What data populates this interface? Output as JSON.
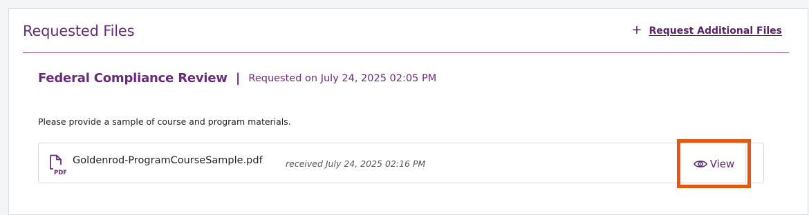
{
  "section": {
    "title": "Requested Files",
    "request_more_label": "Request Additional Files",
    "plus_symbol": "+"
  },
  "request": {
    "title": "Federal Compliance Review",
    "separator": "|",
    "requested_on": "Requested on July 24, 2025 02:05 PM",
    "description": "Please provide a sample of course and program materials."
  },
  "file": {
    "name": "Goldenrod-ProgramCourseSample.pdf",
    "received": "received July 24, 2025 02:16 PM",
    "icon_label": "PDF",
    "view_label": "View"
  },
  "colors": {
    "brand_purple": "#6a2a7c",
    "highlight_orange": "#e5560e"
  },
  "icons": {
    "add": "plus-icon",
    "file": "pdf-file-icon",
    "view": "eye-icon"
  }
}
